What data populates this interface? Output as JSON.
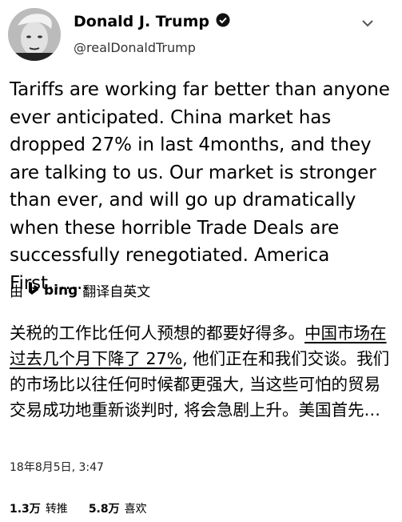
{
  "user": {
    "name": "Donald J. Trump",
    "handle": "@realDonaldTrump"
  },
  "tweet": {
    "text": "Tariffs are working far better than anyone ever anticipated. China market has dropped 27% in last 4months, and they are talking to us. Our market is stronger than ever, and will go up dramatically when these horrible Trade Deals are successfully renegotiated. America First......."
  },
  "translation": {
    "prefix": "由",
    "brand": "bing",
    "suffix": "翻译自英文",
    "text_before": "关税的工作比任何人预想的都要好得多。",
    "text_underlined": "中国市场在过去几个月下降了 27%",
    "text_after": ", 他们正在和我们交谈。我们的市场比以往任何时候都更强大, 当这些可怕的贸易交易成功地重新谈判时, 将会急剧上升。美国首先…"
  },
  "meta": {
    "date": "18年8月5日, 3:47",
    "retweets_count": "1.3万",
    "retweets_label": "转推",
    "likes_count": "5.8万",
    "likes_label": "喜欢"
  }
}
